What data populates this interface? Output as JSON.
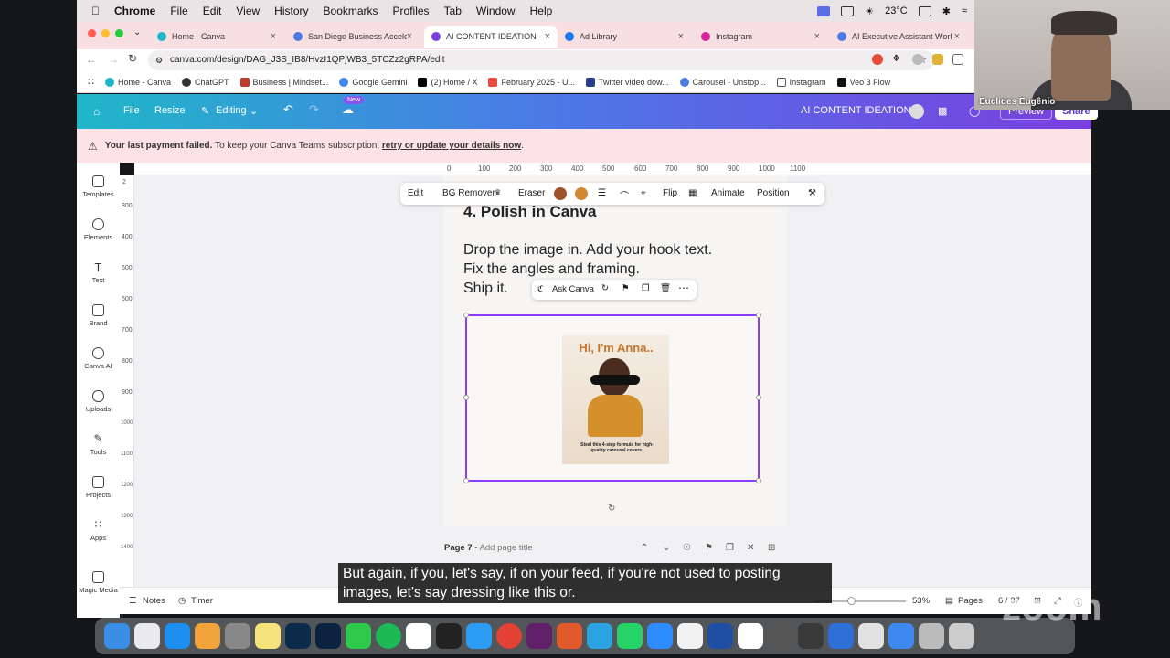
{
  "menubar": {
    "app": "Chrome",
    "items": [
      "File",
      "Edit",
      "View",
      "History",
      "Bookmarks",
      "Profiles",
      "Tab",
      "Window",
      "Help"
    ],
    "temperature": "23°C"
  },
  "tabs": [
    {
      "title": "Home - Canva",
      "color": "#1fb7c8"
    },
    {
      "title": "San Diego Business Accele",
      "color": "#4a7be6"
    },
    {
      "title": "AI CONTENT IDEATION - Inst",
      "color": "#7a3ee0"
    },
    {
      "title": "Ad Library",
      "color": "#1877f2"
    },
    {
      "title": "Instagram",
      "color": "#d6249f"
    },
    {
      "title": "AI Executive Assistant Work",
      "color": "#4a7be6"
    }
  ],
  "url": "canva.com/design/DAG_J3S_IB8/HvzI1QPjWB3_5TCZz2gRPA/edit",
  "bookmarks": [
    {
      "label": "Home - Canva",
      "color": "#1fb7c8"
    },
    {
      "label": "ChatGPT",
      "color": "#333333"
    },
    {
      "label": "Business | Mindset...",
      "color": "#c0392b"
    },
    {
      "label": "Google Gemini",
      "color": "#4285f4"
    },
    {
      "label": "(2) Home / X",
      "color": "#000000"
    },
    {
      "label": "February 2025 - U...",
      "color": "#e74c3c"
    },
    {
      "label": "Twitter video dow...",
      "color": "#2c3e91"
    },
    {
      "label": "Carousel - Unstop...",
      "color": "#4a7be6"
    },
    {
      "label": "Instagram",
      "color": "#555555"
    },
    {
      "label": "Veo 3 Flow",
      "color": "#111111"
    }
  ],
  "canva": {
    "file": "File",
    "resize": "Resize",
    "editing": "Editing",
    "new_badge": "New",
    "design_title": "AI CONTENT IDEATION",
    "preview": "Preview",
    "share": "Share"
  },
  "alert": {
    "bold": "Your last payment failed.",
    "text": "To keep your Canva Teams subscription,",
    "link": "retry or update your details now",
    "end": "."
  },
  "sidebar": [
    "Templates",
    "Elements",
    "Text",
    "Brand",
    "Canva AI",
    "Uploads",
    "Tools",
    "Projects",
    "Apps",
    "Magic Media"
  ],
  "ruler_top": [
    "0",
    "100",
    "200",
    "300",
    "400",
    "500",
    "600",
    "700",
    "800",
    "900",
    "1000",
    "1100"
  ],
  "ruler_left": [
    "2",
    "300",
    "400",
    "500",
    "600",
    "700",
    "800",
    "900",
    "1000",
    "1100",
    "1200",
    "1300",
    "1400"
  ],
  "context_toolbar": {
    "edit": "Edit",
    "bg_remover": "BG Remover",
    "eraser": "Eraser",
    "flip": "Flip",
    "animate": "Animate",
    "position": "Position",
    "color1": "#a0522d",
    "color2": "#d2862f"
  },
  "content": {
    "heading": "4. Polish in Canva",
    "lines": [
      "Drop the image in. Add your hook text.",
      "Fix the angles and framing.",
      "Ship it."
    ]
  },
  "ask_canva": "Ask Canva",
  "thumbnail": {
    "title": "Hi, I'm Anna..",
    "caption": "Steal this 4-step formula for high-quality carousel covers."
  },
  "page_label": {
    "page": "Page 7",
    "sep": " - ",
    "placeholder": "Add page title"
  },
  "bottom": {
    "notes": "Notes",
    "timer": "Timer",
    "zoom": "53%",
    "pages": "Pages",
    "page_count": "6 / 37"
  },
  "subtitle": "But again, if you, let's say, if on your feed, if you're not used to posting images, let's say dressing like this or.",
  "webcam_name": "Euclides Eugênio",
  "watermark": "zoom"
}
